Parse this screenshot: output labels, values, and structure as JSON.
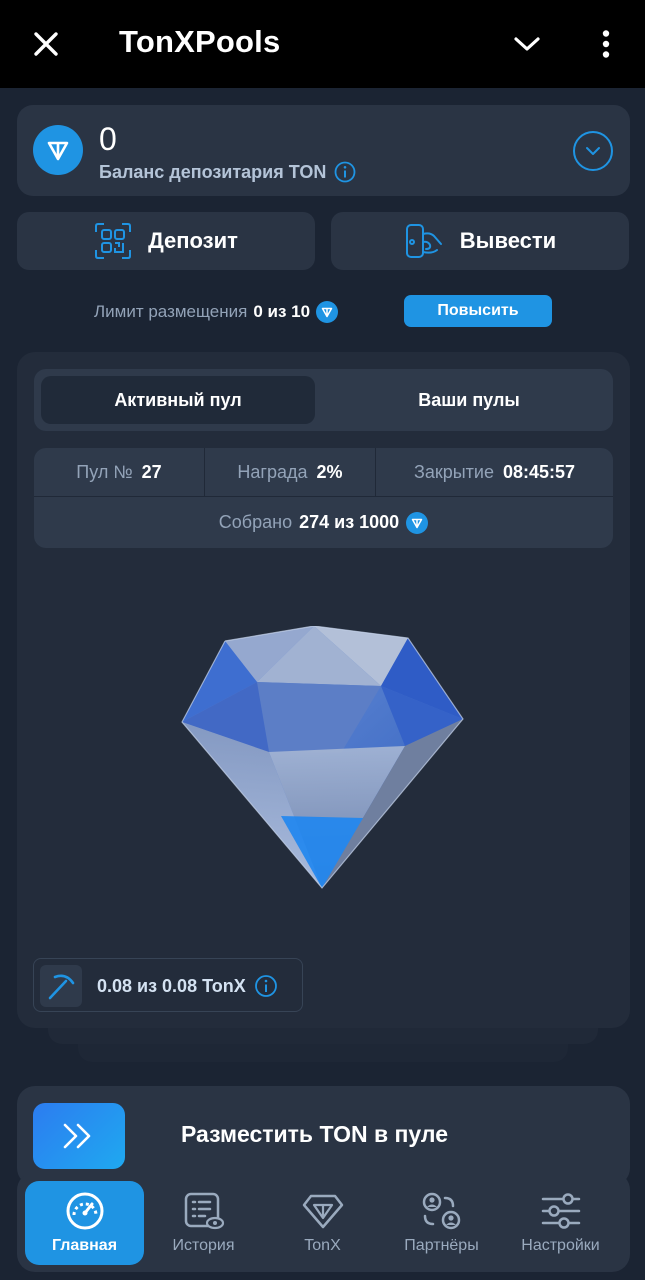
{
  "header": {
    "title": "TonXPools"
  },
  "balance": {
    "value": "0",
    "label": "Баланс депозитария TON"
  },
  "actions": {
    "deposit": "Депозит",
    "withdraw": "Вывести"
  },
  "limit": {
    "label": "Лимит размещения",
    "value": "0 из 10",
    "raise_button": "Повысить"
  },
  "tabs": [
    {
      "label": "Активный пул",
      "active": true
    },
    {
      "label": "Ваши пулы",
      "active": false
    }
  ],
  "pool": {
    "number_label": "Пул №",
    "number": "27",
    "reward_label": "Награда",
    "reward": "2%",
    "closing_label": "Закрытие",
    "closing": "08:45:57",
    "collected_label": "Собрано",
    "collected": "274 из 1000"
  },
  "mining": {
    "text": "0.08 из 0.08 TonX"
  },
  "place": {
    "label": "Разместить TON в пуле"
  },
  "nav": [
    {
      "label": "Главная",
      "icon": "speedometer-icon",
      "active": true
    },
    {
      "label": "История",
      "icon": "history-list-icon",
      "active": false
    },
    {
      "label": "TonX",
      "icon": "tonx-diamond-icon",
      "active": false
    },
    {
      "label": "Партнёры",
      "icon": "partners-icon",
      "active": false
    },
    {
      "label": "Настройки",
      "icon": "sliders-icon",
      "active": false
    }
  ],
  "colors": {
    "accent": "#1f94e3",
    "background": "#1b2433",
    "card": "#2a3444"
  }
}
